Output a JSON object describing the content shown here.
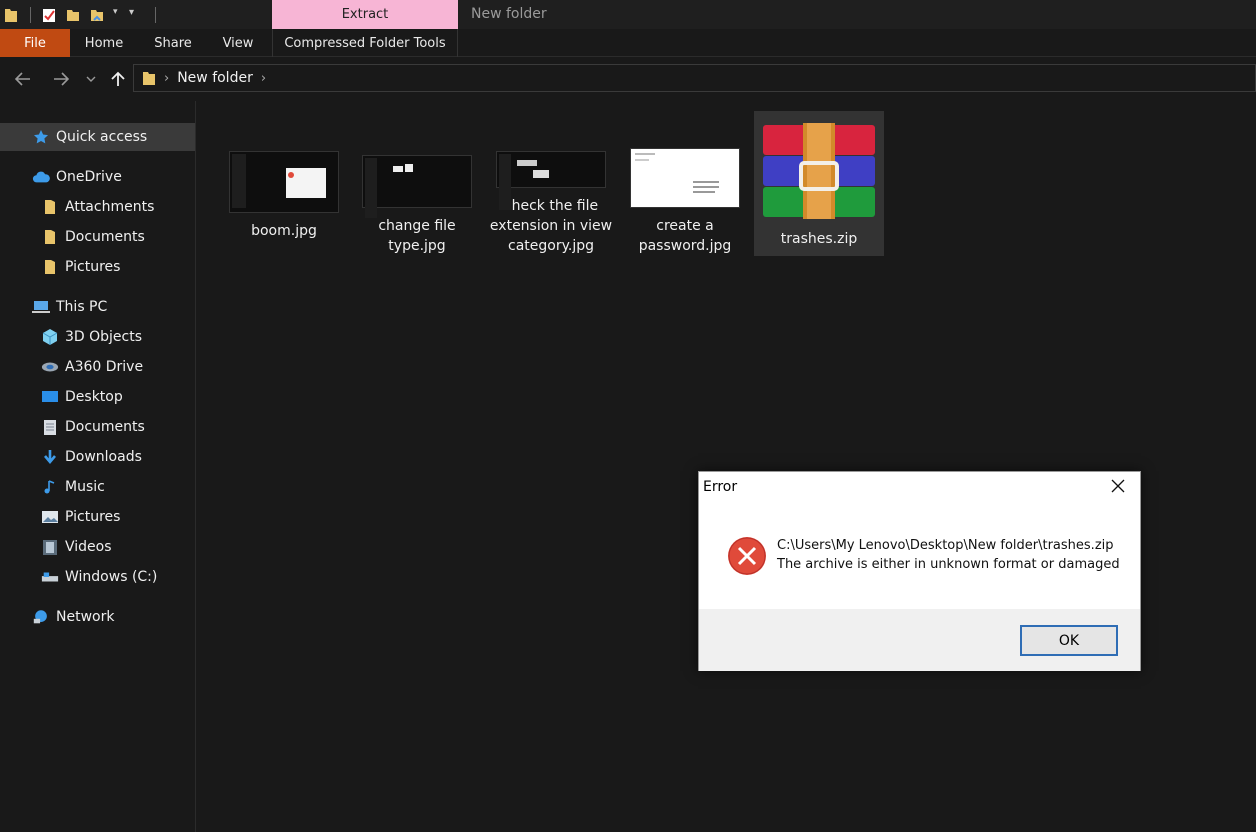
{
  "window": {
    "context_tab": "Extract",
    "title": "New folder"
  },
  "ribbon": {
    "tabs": [
      {
        "label": "File"
      },
      {
        "label": "Home"
      },
      {
        "label": "Share"
      },
      {
        "label": "View"
      },
      {
        "label": "Compressed Folder Tools"
      }
    ]
  },
  "address": {
    "crumbs": [
      "New folder"
    ]
  },
  "sidebar": {
    "items": [
      {
        "label": "Quick access",
        "icon": "star-icon"
      },
      {
        "label": "OneDrive",
        "icon": "cloud-icon"
      },
      {
        "label": "Attachments",
        "icon": "folder-icon"
      },
      {
        "label": "Documents",
        "icon": "folder-icon"
      },
      {
        "label": "Pictures",
        "icon": "folder-icon"
      },
      {
        "label": "This PC",
        "icon": "computer-icon"
      },
      {
        "label": "3D Objects",
        "icon": "cube-icon"
      },
      {
        "label": "A360 Drive",
        "icon": "drive-icon"
      },
      {
        "label": "Desktop",
        "icon": "desktop-icon"
      },
      {
        "label": "Documents",
        "icon": "document-icon"
      },
      {
        "label": "Downloads",
        "icon": "download-icon"
      },
      {
        "label": "Music",
        "icon": "music-icon"
      },
      {
        "label": "Pictures",
        "icon": "picture-icon"
      },
      {
        "label": "Videos",
        "icon": "video-icon"
      },
      {
        "label": "Windows (C:)",
        "icon": "disk-icon"
      },
      {
        "label": "Network",
        "icon": "network-icon"
      }
    ]
  },
  "files": [
    {
      "name": "boom.jpg"
    },
    {
      "name": "change file type.jpg"
    },
    {
      "name": "check the file extension in view category.jpg"
    },
    {
      "name": "create a password.jpg"
    },
    {
      "name": "trashes.zip"
    }
  ],
  "dialog": {
    "title": "Error",
    "path": "C:\\Users\\My Lenovo\\Desktop\\New folder\\trashes.zip",
    "message": "The archive is either in unknown format or damaged",
    "ok_label": "OK"
  },
  "colors": {
    "file_tab": "#c04a12",
    "context_tab": "#f7b5d5",
    "error_red": "#e04a3a",
    "ok_border": "#2f6db5"
  }
}
